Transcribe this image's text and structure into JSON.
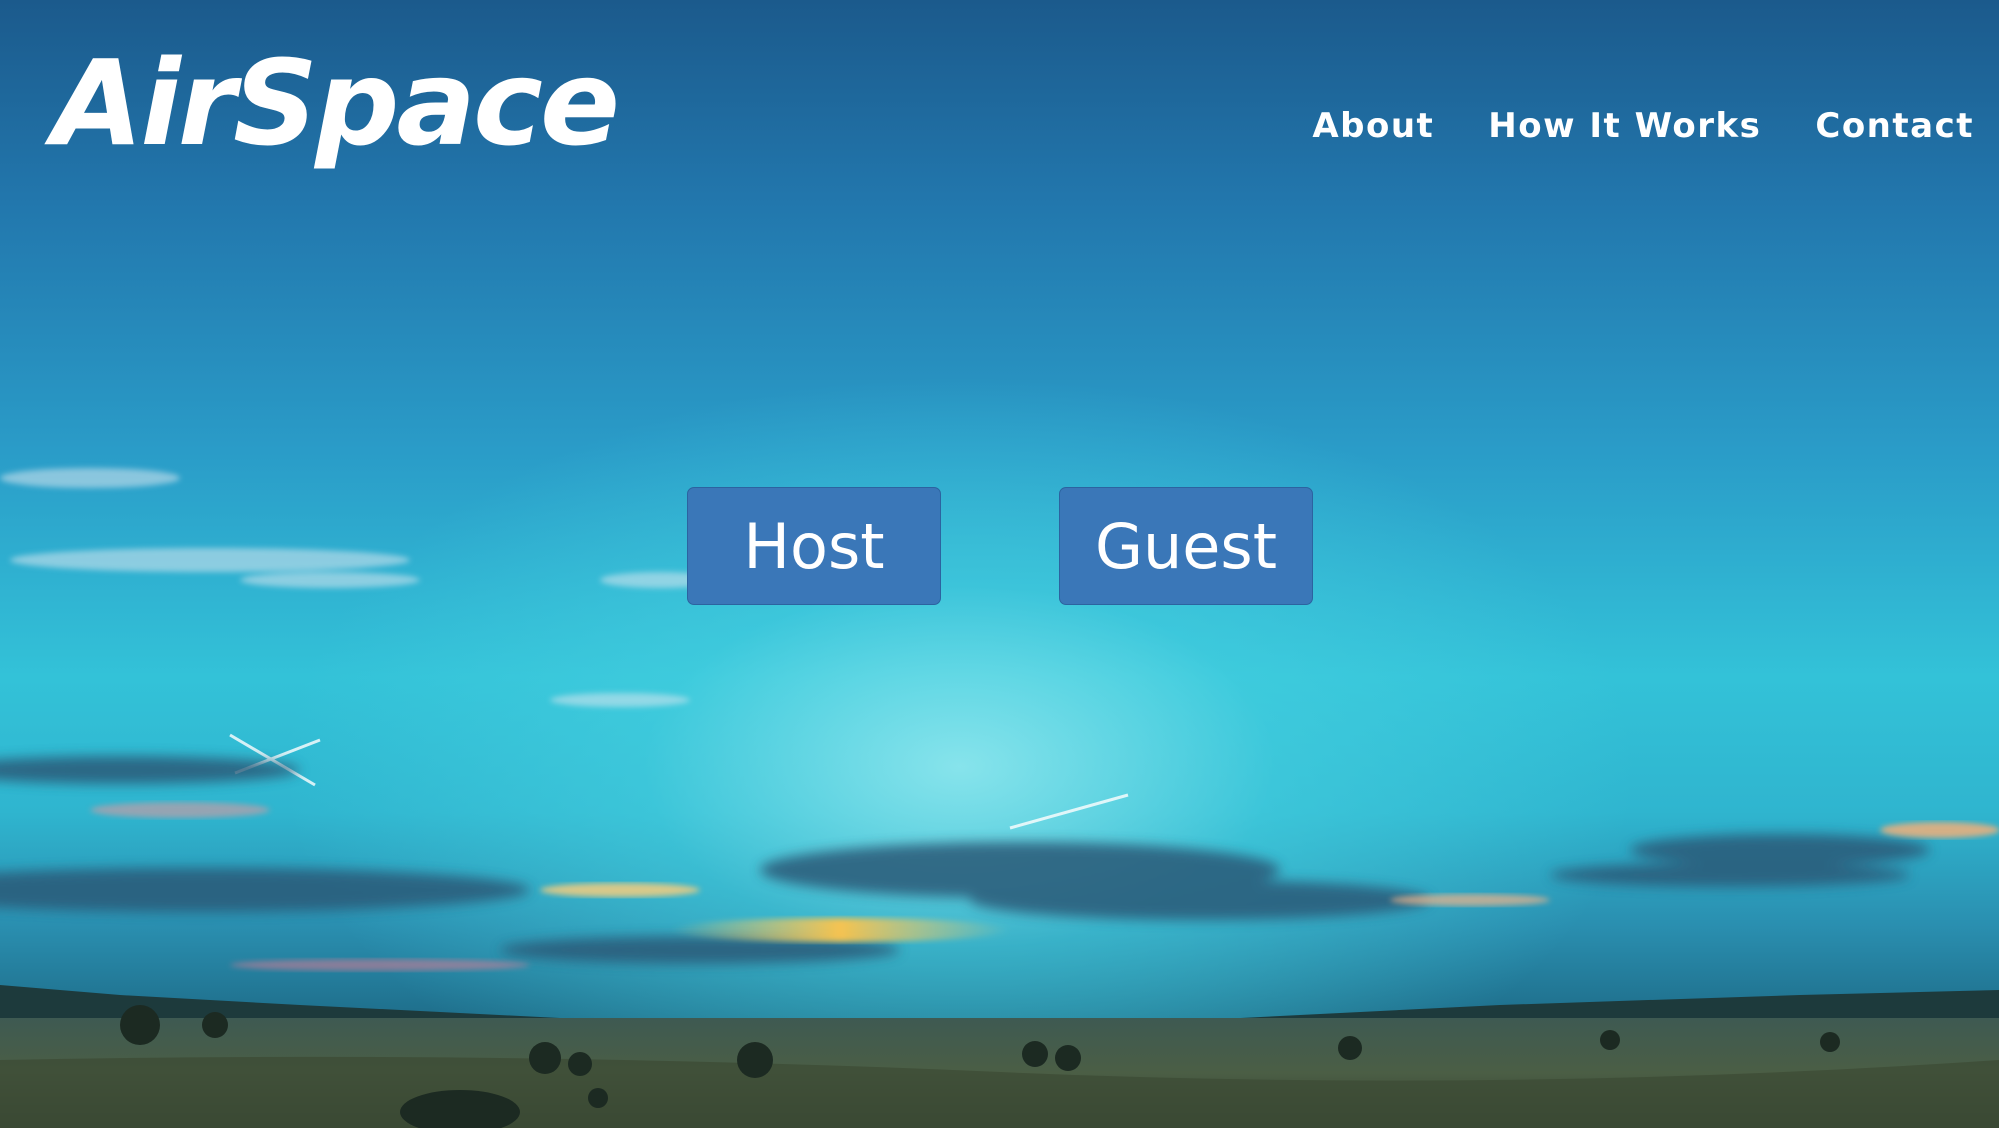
{
  "brand": {
    "name": "AirSpace"
  },
  "nav": {
    "items": [
      {
        "label": "About"
      },
      {
        "label": "How It Works"
      },
      {
        "label": "Contact"
      }
    ]
  },
  "hero": {
    "background": "twilight-sky-over-meadow-photo",
    "buttons": {
      "host_label": "Host",
      "guest_label": "Guest"
    }
  },
  "colors": {
    "button_fill": "#3a77b8",
    "text": "#ffffff",
    "sky_top": "#1b5a8c",
    "sky_mid": "#33c2d8"
  }
}
